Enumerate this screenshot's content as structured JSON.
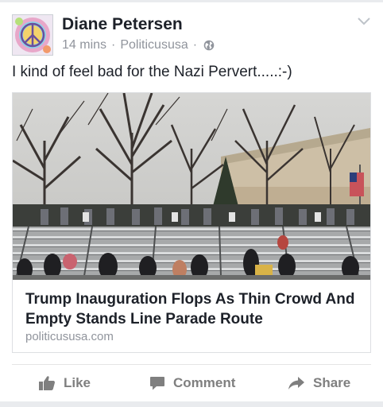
{
  "post": {
    "author": "Diane Petersen",
    "time": "14 mins",
    "source": "Politicususa",
    "separator": "·",
    "text": "I kind of feel bad for the Nazi Pervert.....:-)"
  },
  "link": {
    "title": "Trump Inauguration Flops As Thin Crowd And Empty Stands Line Parade Route",
    "domain": "politicususa.com"
  },
  "actions": {
    "like": "Like",
    "comment": "Comment",
    "share": "Share"
  },
  "icons": {
    "privacy": "globe-icon",
    "menu": "chevron-down-icon",
    "like": "thumbs-up-icon",
    "comment": "comment-bubble-icon",
    "share": "share-arrow-icon"
  },
  "colors": {
    "text": "#1d2129",
    "secondary": "#90949c",
    "action": "#7f7f7f"
  }
}
